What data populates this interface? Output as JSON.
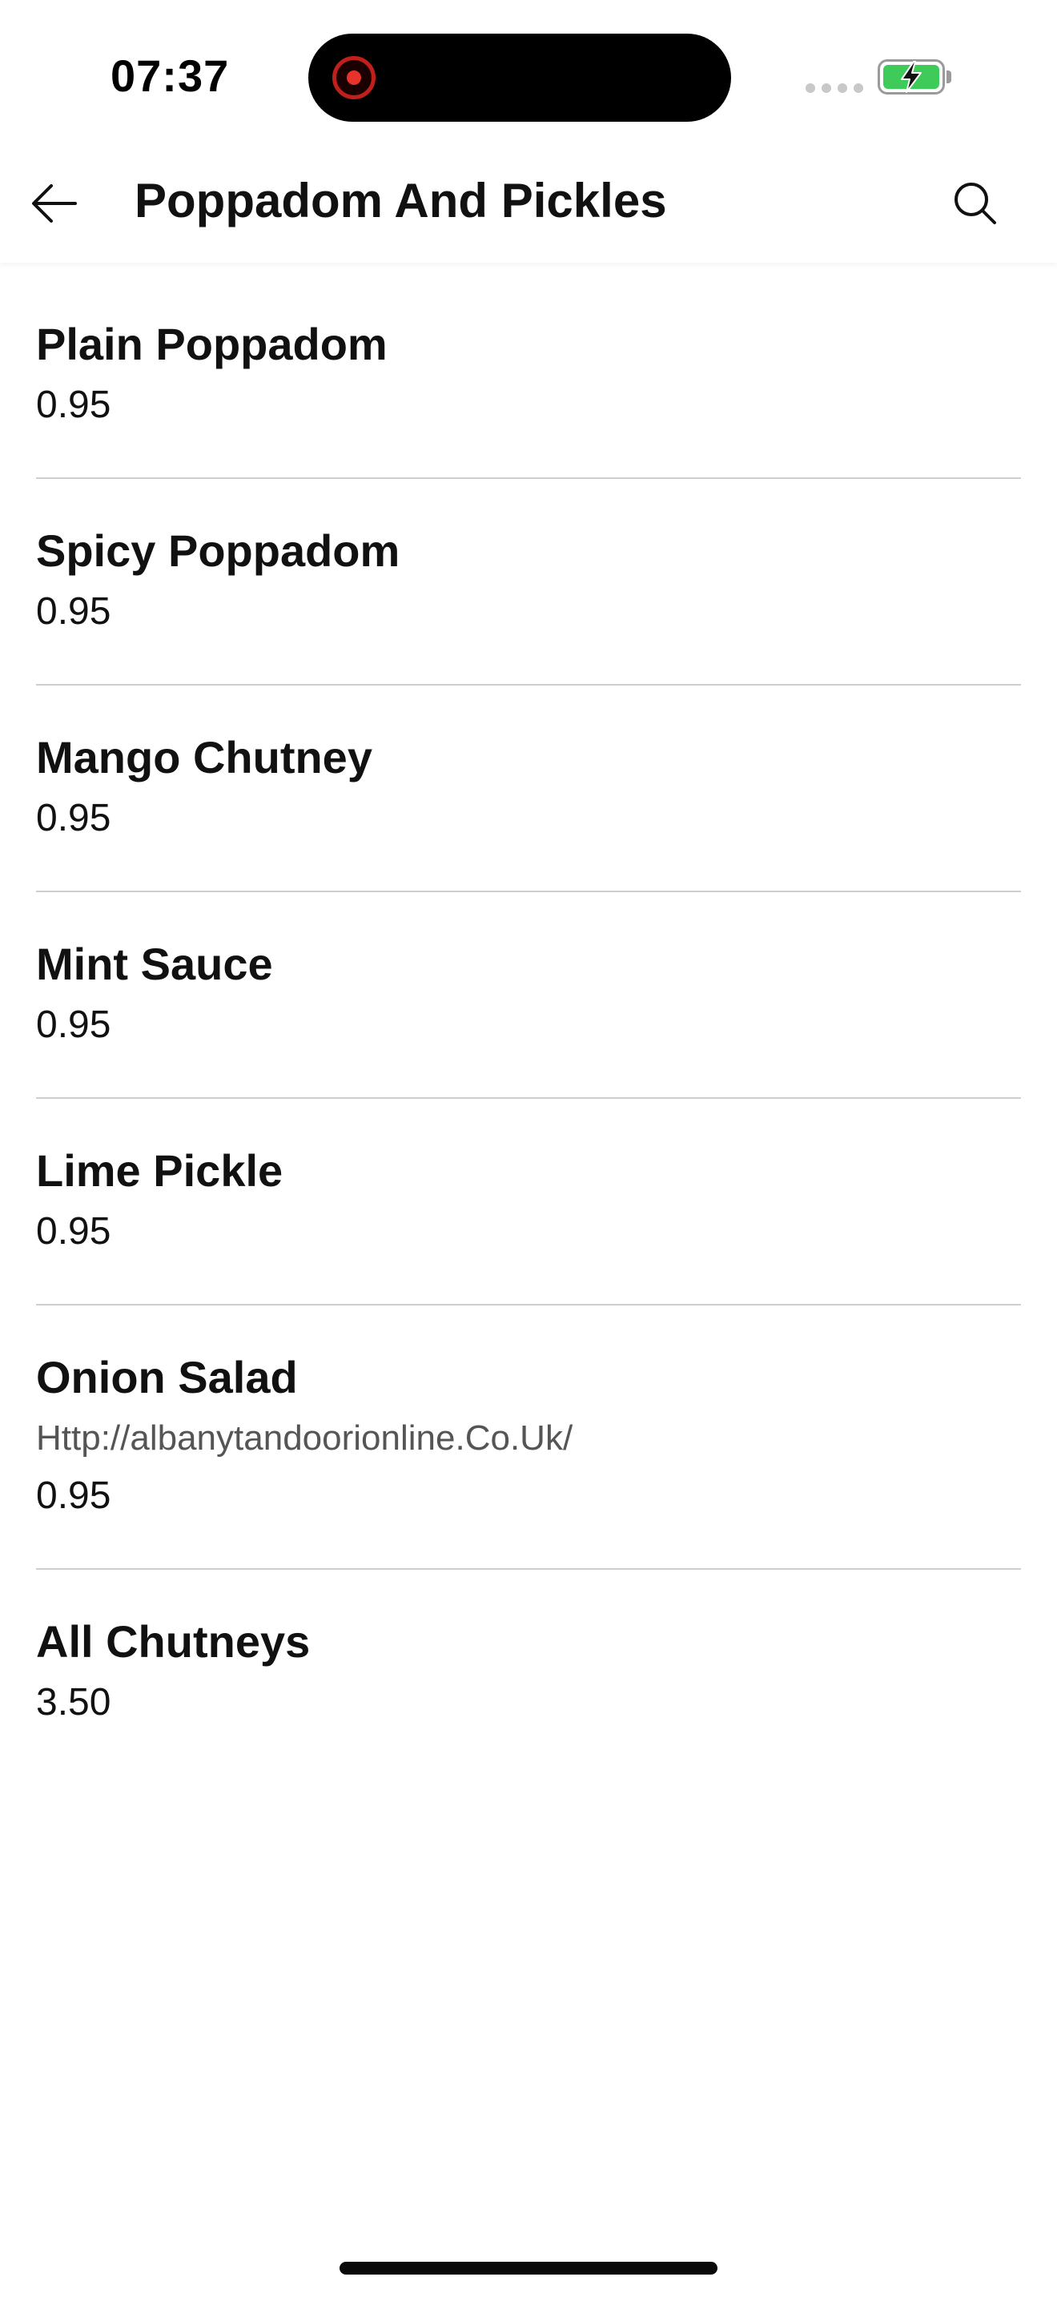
{
  "status_bar": {
    "time": "07:37",
    "colors": {
      "battery_fill": "#3ecb5a",
      "record_indicator": "#e7332b"
    }
  },
  "header": {
    "title": "Poppadom And Pickles",
    "back_icon": "arrow-left-icon",
    "search_icon": "search-icon"
  },
  "menu": {
    "items": [
      {
        "name": "Plain Poppadom",
        "description": "",
        "price": "0.95"
      },
      {
        "name": "Spicy Poppadom",
        "description": "",
        "price": "0.95"
      },
      {
        "name": "Mango Chutney",
        "description": "",
        "price": "0.95"
      },
      {
        "name": "Mint Sauce",
        "description": "",
        "price": "0.95"
      },
      {
        "name": "Lime Pickle",
        "description": "",
        "price": "0.95"
      },
      {
        "name": "Onion Salad",
        "description": "Http://albanytandoorionline.Co.Uk/",
        "price": "0.95"
      },
      {
        "name": "All Chutneys",
        "description": "",
        "price": "3.50"
      }
    ]
  }
}
